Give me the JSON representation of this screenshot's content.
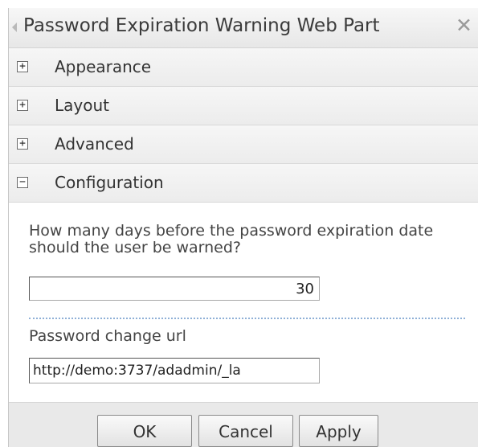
{
  "panel": {
    "title": "Password Expiration Warning Web Part",
    "collapse_glyph": "◀",
    "close_glyph": "✕"
  },
  "sections": [
    {
      "label": "Appearance",
      "state": "+"
    },
    {
      "label": "Layout",
      "state": "+"
    },
    {
      "label": "Advanced",
      "state": "+"
    },
    {
      "label": "Configuration",
      "state": "−"
    }
  ],
  "configuration": {
    "days_question": "How many days before the password expiration date should the user be warned?",
    "days_value": "30",
    "url_label": "Password change url",
    "url_value": "http://demo:3737/adadmin/_la"
  },
  "buttons": {
    "ok": "OK",
    "cancel": "Cancel",
    "apply": "Apply"
  },
  "colors": {
    "separator": "#8fb0d7",
    "header_bg": "#efefef"
  }
}
